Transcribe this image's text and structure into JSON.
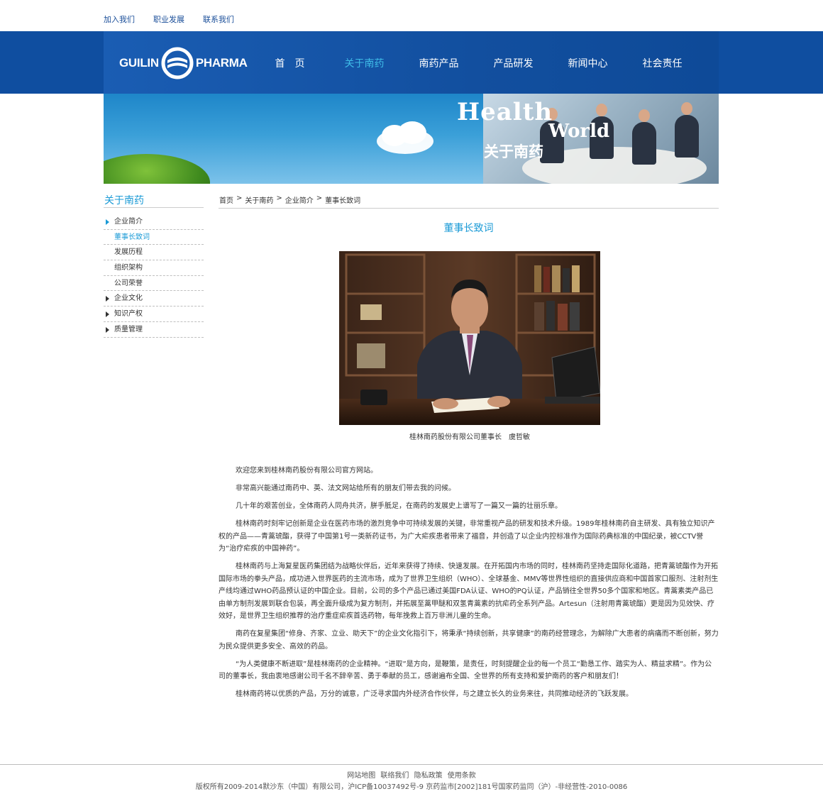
{
  "top_links": [
    "加入我们",
    "职业发展",
    "联系我们"
  ],
  "logo": {
    "left": "GUILIN",
    "right": "PHARMA"
  },
  "nav": {
    "items": [
      "首　页",
      "关于南药",
      "南药产品",
      "产品研发",
      "新闻中心",
      "社会责任"
    ],
    "active_index": 1
  },
  "banner": {
    "word1": "Health",
    "word2": "World",
    "title": "关于南药"
  },
  "sidebar": {
    "title": "关于南药",
    "items": [
      {
        "label": "企业简介",
        "arrow": true,
        "active": false
      },
      {
        "label": "董事长致词",
        "arrow": false,
        "active": true
      },
      {
        "label": "发展历程",
        "arrow": false,
        "active": false
      },
      {
        "label": "组织架构",
        "arrow": false,
        "active": false
      },
      {
        "label": "公司荣誉",
        "arrow": false,
        "active": false
      },
      {
        "label": "企业文化",
        "arrow": true,
        "active": false
      },
      {
        "label": "知识产权",
        "arrow": true,
        "active": false
      },
      {
        "label": "质量管理",
        "arrow": true,
        "active": false
      }
    ]
  },
  "breadcrumb": [
    "首页",
    "关于南药",
    "企业简介",
    "董事长致词"
  ],
  "breadcrumb_sep": ">",
  "article": {
    "title": "董事长致词",
    "caption": "桂林南药股份有限公司董事长　虞哲敏",
    "paragraphs": [
      "欢迎您来到桂林南药股份有限公司官方网站。",
      "非常高兴能通过南药中、英、法文网站给所有的朋友们带去我的问候。",
      "几十年的艰苦创业，全体南药人同舟共济，胼手胝足，在南药的发展史上谱写了一篇又一篇的壮丽乐章。",
      "桂林南药时刻牢记创新是企业在医药市场的激烈竞争中可持续发展的关键，非常重视产品的研发和技术升级。1989年桂林南药自主研发、具有独立知识产权的产品——青蒿琥酯，获得了中国第1号一类新药证书，为广大疟疾患者带来了福音，并创造了以企业内控标准作为国际药典标准的中国纪录，被CCTV誉为“治疗疟疾的中国神药”。",
      "桂林南药与上海复星医药集团结为战略伙伴后，近年来获得了持续、快速发展。在开拓国内市场的同时，桂林南药坚持走国际化道路，把青蒿琥酯作为开拓国际市场的拳头产品，成功进入世界医药的主流市场，成为了世界卫生组织（WHO）、全球基金、MMV等世界性组织的直接供应商和中国首家口服剂、注射剂生产线均通过WHO药品预认证的中国企业。目前，公司的多个产品已通过美国FDA认证、WHO的PQ认证，产品销往全世界50多个国家和地区。青蒿素类产品已由单方制剂发展到联合包装，再全面升级成为复方制剂，并拓展至蒿甲醚和双氢青蒿素的抗疟药全系列产品。Artesun（注射用青蒿琥酯）更是因为见效快、疗效好，是世界卫生组织推荐的治疗重症疟疾首选药物，每年挽救上百万非洲儿童的生命。",
      "南药在复星集团“修身、齐家、立业、助天下”的企业文化指引下，将秉承“持续创新，共享健康”的南药经营理念，为解除广大患者的病痛而不断创新，努力为民众提供更多安全、高效的药品。",
      "“为人类健康不断进取”是桂林南药的企业精神。“进取”是方向，是鞭策，是责任，时刻提醒企业的每一个员工“勤恳工作、踏实为人、精益求精”。作为公司的董事长，我由衷地感谢公司千名不辞辛苦、勇于奉献的员工，感谢遍布全国、全世界的所有支持和爱护南药的客户和朋友们！",
      "桂林南药将以优质的产品，万分的诚意，广泛寻求国内外经济合作伙伴，与之建立长久的业务来往，共同推动经济的飞跃发展。"
    ]
  },
  "footer": {
    "links": [
      "网站地图",
      "联络我们",
      "隐私政策",
      "使用条款"
    ],
    "copyright": "版权所有2009-2014默沙东（中国）有限公司，沪ICP备10037492号-9  京药监市[2002]181号国家药监同（沪）-非经营性-2010-0086"
  },
  "colors": {
    "nav_bg": "#0f4ea0",
    "accent": "#1a9ad6",
    "active_nav": "#3fbde8"
  }
}
